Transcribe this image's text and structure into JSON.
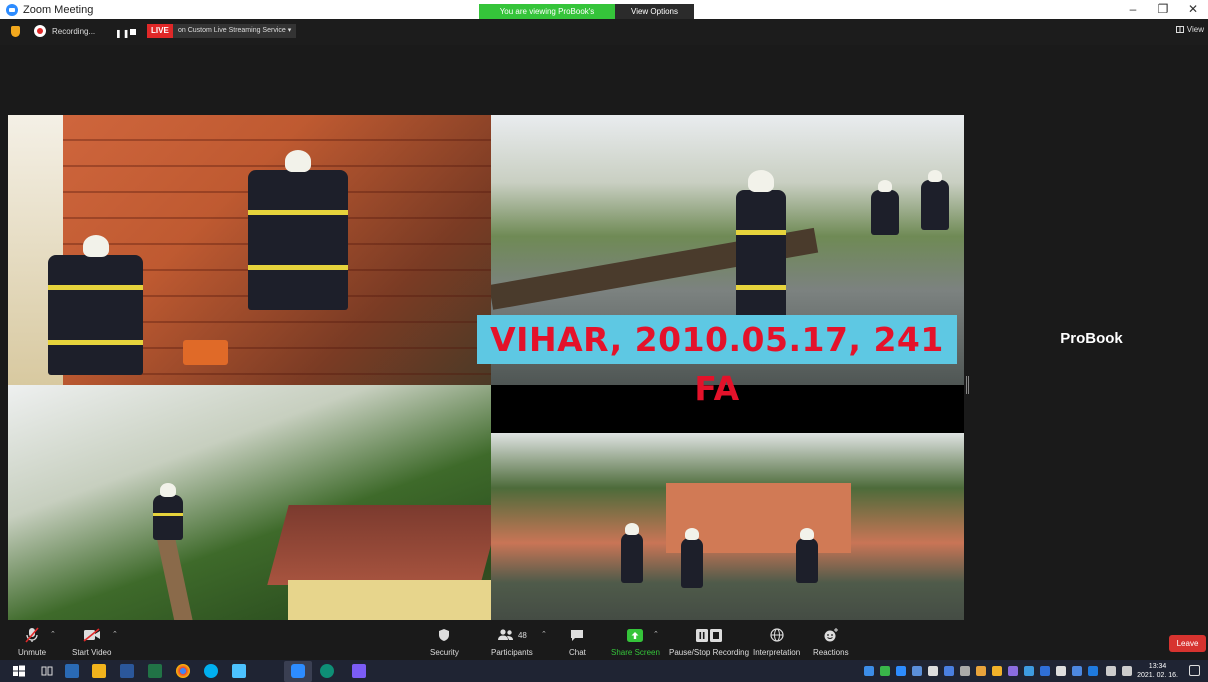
{
  "window": {
    "title": "Zoom Meeting",
    "viewing_banner": "You are viewing ProBook's screen",
    "view_options": "View Options ⌄",
    "controls": [
      "–",
      "❐",
      "✕"
    ]
  },
  "meeting_bar": {
    "recording_label": "Recording...",
    "live_label": "LIVE",
    "live_service": "on Custom Live Streaming Service ▾",
    "view_label": "View"
  },
  "shared_screen": {
    "caption": "VIHAR, 2010.05.17, 241 FA"
  },
  "participant": {
    "name": "ProBook"
  },
  "toolbar": {
    "unmute": "Unmute",
    "start_video": "Start Video",
    "security": "Security",
    "participants": "Participants",
    "participants_count": "48",
    "chat": "Chat",
    "share_screen": "Share Screen",
    "pause_recording": "Pause/Stop Recording",
    "interpretation": "Interpretation",
    "reactions": "Reactions",
    "leave": "Leave"
  },
  "taskbar": {
    "time": "13:34",
    "date": "2021. 02. 16."
  },
  "colors": {
    "live_red": "#e02828",
    "share_green": "#35c43a",
    "leave_red": "#d7332f",
    "caption_bg": "#5ec8e3",
    "caption_text": "#e4122a"
  }
}
